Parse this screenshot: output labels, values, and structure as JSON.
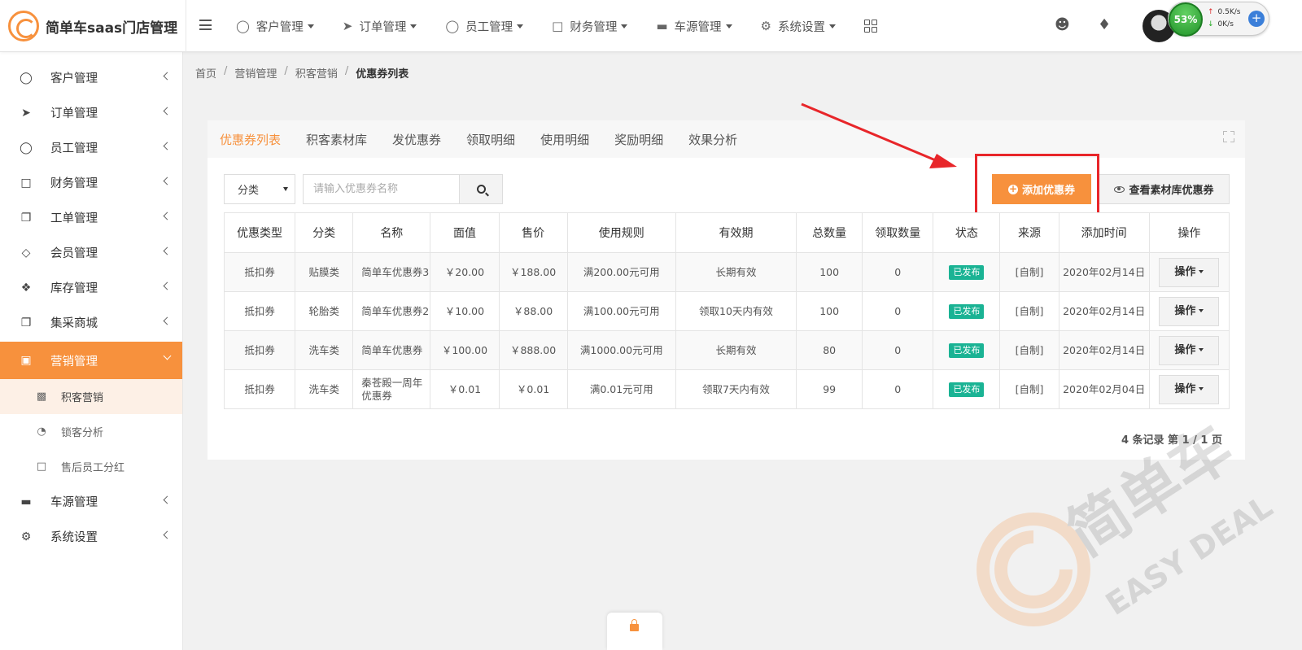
{
  "app": {
    "title": "简单车saas门店管理"
  },
  "topnav": [
    {
      "label": "客户管理",
      "icon": "user-icon"
    },
    {
      "label": "订单管理",
      "icon": "rocket-icon"
    },
    {
      "label": "员工管理",
      "icon": "user-icon"
    },
    {
      "label": "财务管理",
      "icon": "folder-icon"
    },
    {
      "label": "车源管理",
      "icon": "car-icon"
    },
    {
      "label": "系统设置",
      "icon": "gear-icon"
    }
  ],
  "speed": {
    "percent": "53%",
    "up": "0.5K/s",
    "down": "0K/s"
  },
  "sidebar": {
    "items": [
      {
        "label": "客户管理"
      },
      {
        "label": "订单管理"
      },
      {
        "label": "员工管理"
      },
      {
        "label": "财务管理"
      },
      {
        "label": "工单管理"
      },
      {
        "label": "会员管理"
      },
      {
        "label": "库存管理"
      },
      {
        "label": "集采商城"
      },
      {
        "label": "营销管理"
      },
      {
        "label": "车源管理"
      },
      {
        "label": "系统设置"
      }
    ],
    "sub": [
      {
        "label": "积客营销"
      },
      {
        "label": "锁客分析"
      },
      {
        "label": "售后员工分红"
      }
    ]
  },
  "breadcrumb": [
    "首页",
    "营销管理",
    "积客营销",
    "优惠券列表"
  ],
  "tabs": [
    "优惠券列表",
    "积客素材库",
    "发优惠券",
    "领取明细",
    "使用明细",
    "奖励明细",
    "效果分析"
  ],
  "filter": {
    "category": "分类",
    "search_placeholder": "请输入优惠券名称"
  },
  "buttons": {
    "add": "添加优惠券",
    "view_library": "查看素材库优惠券"
  },
  "table": {
    "headers": [
      "优惠类型",
      "分类",
      "名称",
      "面值",
      "售价",
      "使用规则",
      "有效期",
      "总数量",
      "领取数量",
      "状态",
      "来源",
      "添加时间",
      "操作"
    ],
    "rows": [
      {
        "type": "抵扣券",
        "category": "贴膜类",
        "name": "简单车优惠券3",
        "face": "￥20.00",
        "price": "￥188.00",
        "rule": "满200.00元可用",
        "validity": "长期有效",
        "total": "100",
        "claimed": "0",
        "status": "已发布",
        "source": "[自制]",
        "added": "2020年02月14日",
        "op": "操作"
      },
      {
        "type": "抵扣券",
        "category": "轮胎类",
        "name": "简单车优惠券2",
        "face": "￥10.00",
        "price": "￥88.00",
        "rule": "满100.00元可用",
        "validity": "领取10天内有效",
        "total": "100",
        "claimed": "0",
        "status": "已发布",
        "source": "[自制]",
        "added": "2020年02月14日",
        "op": "操作"
      },
      {
        "type": "抵扣券",
        "category": "洗车类",
        "name": "简单车优惠券",
        "face": "￥100.00",
        "price": "￥888.00",
        "rule": "满1000.00元可用",
        "validity": "长期有效",
        "total": "80",
        "claimed": "0",
        "status": "已发布",
        "source": "[自制]",
        "added": "2020年02月14日",
        "op": "操作"
      },
      {
        "type": "抵扣券",
        "category": "洗车类",
        "name": "秦苍殿一周年优惠券",
        "face": "￥0.01",
        "price": "￥0.01",
        "rule": "满0.01元可用",
        "validity": "领取7天内有效",
        "total": "99",
        "claimed": "0",
        "status": "已发布",
        "source": "[自制]",
        "added": "2020年02月04日",
        "op": "操作"
      }
    ]
  },
  "pager": "4 条记录 第 1 / 1 页",
  "watermark": {
    "brand": "简单车",
    "en": "EASY DEAL"
  },
  "colors": {
    "accent": "#f7913d",
    "success": "#1ab394",
    "annotation": "#e8262a"
  }
}
